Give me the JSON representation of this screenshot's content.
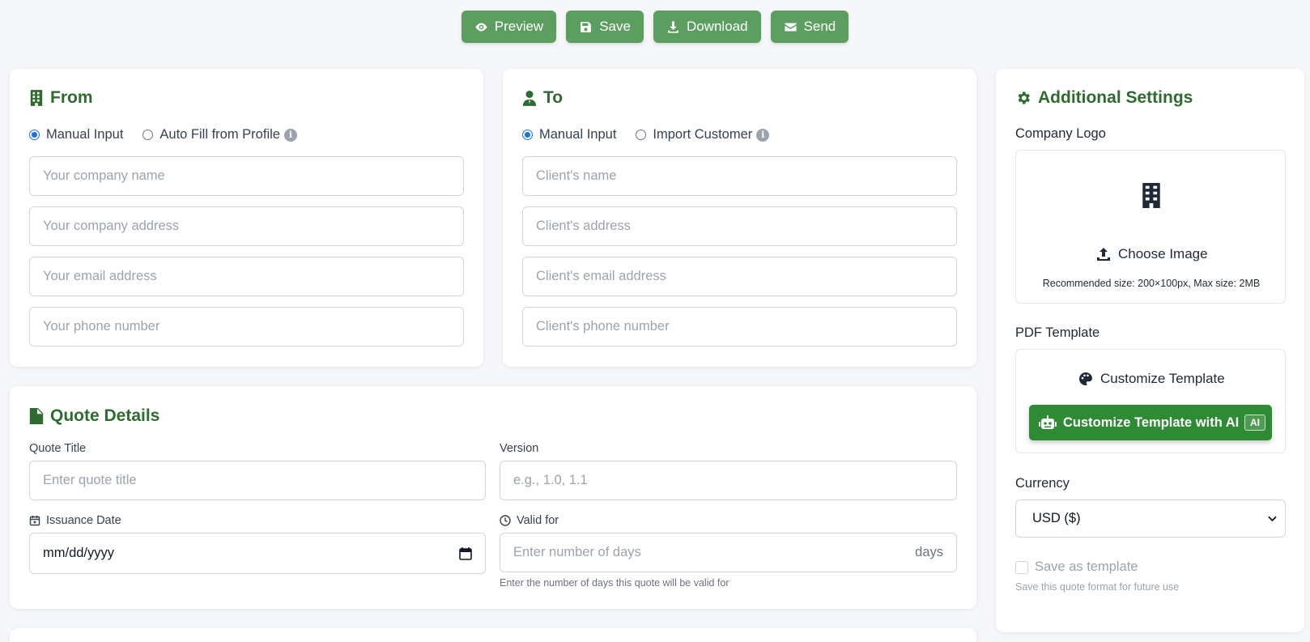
{
  "toolbar": {
    "preview": "Preview",
    "save": "Save",
    "download": "Download",
    "send": "Send"
  },
  "from": {
    "title": "From",
    "radio_manual": "Manual Input",
    "radio_auto": "Auto Fill from Profile",
    "company_name_placeholder": "Your company name",
    "company_address_placeholder": "Your company address",
    "email_placeholder": "Your email address",
    "phone_placeholder": "Your phone number"
  },
  "to": {
    "title": "To",
    "radio_manual": "Manual Input",
    "radio_import": "Import Customer",
    "name_placeholder": "Client's name",
    "address_placeholder": "Client's address",
    "email_placeholder": "Client's email address",
    "phone_placeholder": "Client's phone number"
  },
  "quote": {
    "title": "Quote Details",
    "title_label": "Quote Title",
    "title_placeholder": "Enter quote title",
    "version_label": "Version",
    "version_placeholder": "e.g., 1.0, 1.1",
    "issuance_label": "Issuance Date",
    "issuance_value": "mm/dd/yyyy",
    "valid_label": "Valid for",
    "valid_placeholder": "Enter number of days",
    "valid_suffix": "days",
    "valid_hint": "Enter the number of days this quote will be valid for"
  },
  "settings": {
    "title": "Additional Settings",
    "logo_label": "Company Logo",
    "choose_image": "Choose Image",
    "logo_hint": "Recommended size: 200×100px, Max size: 2MB",
    "pdf_label": "PDF Template",
    "customize": "Customize Template",
    "customize_ai": "Customize Template with AI",
    "ai_badge": "AI",
    "currency_label": "Currency",
    "currency_value": "USD ($)",
    "save_template": "Save as template",
    "save_template_hint": "Save this quote format for future use"
  },
  "colors": {
    "primary_button": "#5c9e5f",
    "title_green": "#2e6b2f",
    "ai_button": "#2f8a34"
  }
}
